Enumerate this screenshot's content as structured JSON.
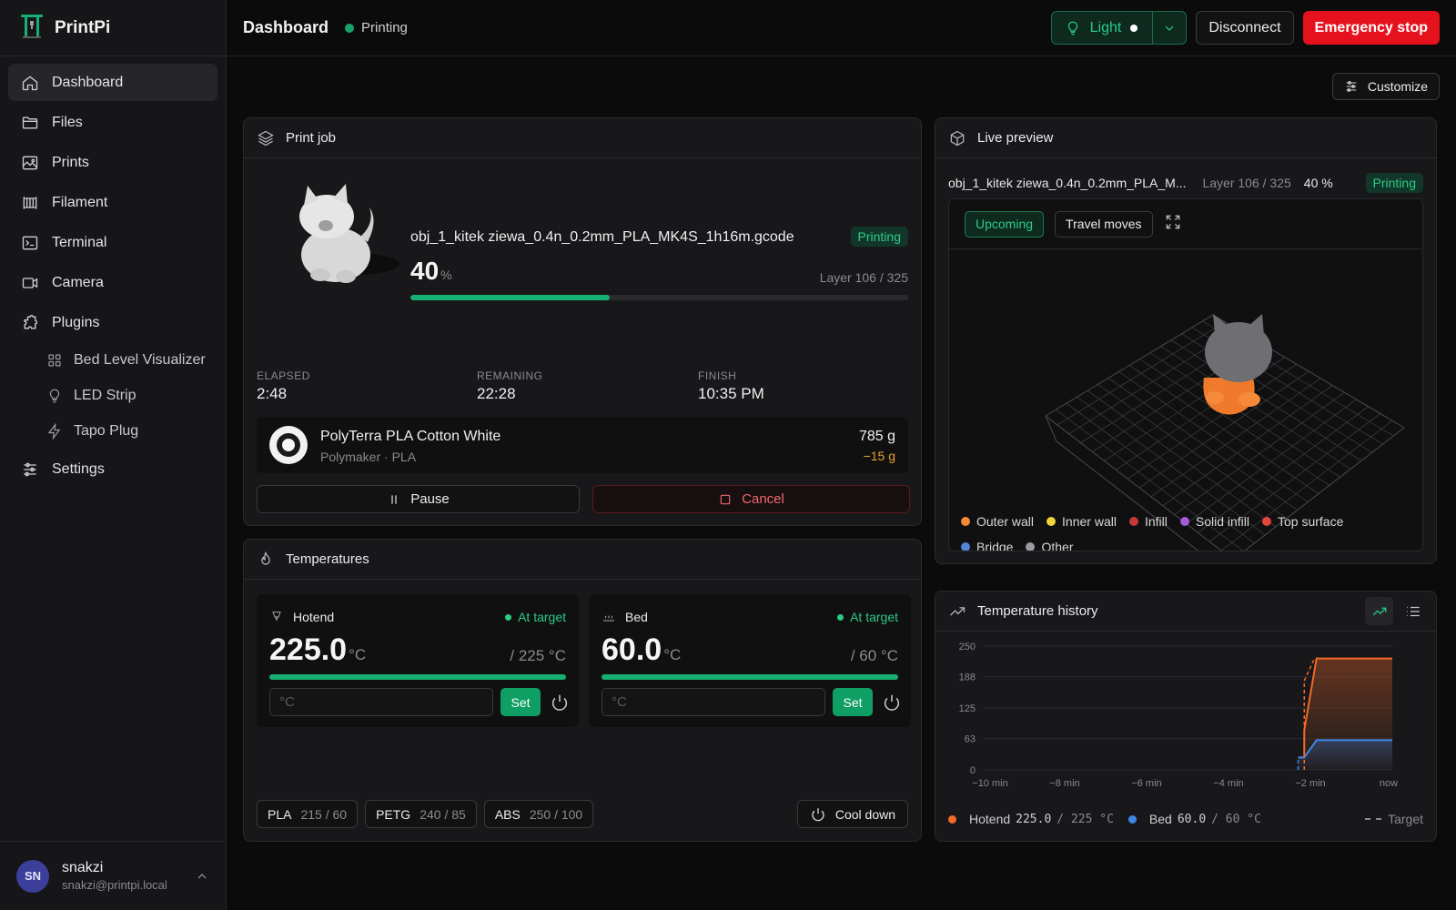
{
  "app": {
    "name": "PrintPi"
  },
  "colors": {
    "accent": "#16b072",
    "danger": "#e5121e",
    "hotend": "#f26a2a",
    "bed": "#3d86e8"
  },
  "sidebar": {
    "items": [
      {
        "label": "Dashboard",
        "icon": "home-icon"
      },
      {
        "label": "Files",
        "icon": "folder-icon"
      },
      {
        "label": "Prints",
        "icon": "image-icon"
      },
      {
        "label": "Filament",
        "icon": "filament-icon"
      },
      {
        "label": "Terminal",
        "icon": "terminal-icon"
      },
      {
        "label": "Camera",
        "icon": "camera-icon"
      },
      {
        "label": "Plugins",
        "icon": "puzzle-icon"
      }
    ],
    "plugins": [
      {
        "label": "Bed Level Visualizer",
        "icon": "grid-icon"
      },
      {
        "label": "LED Strip",
        "icon": "bulb-icon"
      },
      {
        "label": "Tapo Plug",
        "icon": "bolt-icon"
      }
    ],
    "settings": {
      "label": "Settings",
      "icon": "sliders-icon"
    },
    "user": {
      "initials": "SN",
      "name": "snakzi",
      "email": "snakzi@printpi.local"
    }
  },
  "topbar": {
    "title": "Dashboard",
    "status": "Printing",
    "light_label": "Light",
    "disconnect_label": "Disconnect",
    "emergency_label": "Emergency stop"
  },
  "customize_label": "Customize",
  "print_job": {
    "title": "Print job",
    "file": "obj_1_kitek ziewa_0.4n_0.2mm_PLA_MK4S_1h16m.gcode",
    "status": "Printing",
    "percent": "40",
    "percent_unit": "%",
    "progress": 40,
    "layer": "Layer 106 / 325",
    "stats": [
      {
        "label": "ELAPSED",
        "value": "2:48"
      },
      {
        "label": "REMAINING",
        "value": "22:28"
      },
      {
        "label": "FINISH",
        "value": "10:35 PM"
      }
    ],
    "filament": {
      "name": "PolyTerra PLA Cotton White",
      "sub": "Polymaker · PLA",
      "weight": "785 g",
      "delta": "−15 g"
    },
    "pause_label": "Pause",
    "cancel_label": "Cancel"
  },
  "temperatures": {
    "title": "Temperatures",
    "at_target": "At target",
    "hotend": {
      "label": "Hotend",
      "value": "225.0",
      "unit": "°C",
      "target": "/ 225 °C",
      "placeholder": "°C",
      "set_label": "Set"
    },
    "bed": {
      "label": "Bed",
      "value": "60.0",
      "unit": "°C",
      "target": "/ 60 °C",
      "placeholder": "°C",
      "set_label": "Set"
    },
    "presets": [
      {
        "name": "PLA",
        "values": "215 / 60"
      },
      {
        "name": "PETG",
        "values": "240 / 85"
      },
      {
        "name": "ABS",
        "values": "250 / 100"
      }
    ],
    "cooldown_label": "Cool down"
  },
  "preview": {
    "title": "Live preview",
    "file": "obj_1_kitek ziewa_0.4n_0.2mm_PLA_M...",
    "layer": "Layer 106 / 325",
    "percent": "40 %",
    "status": "Printing",
    "upcoming_label": "Upcoming",
    "travel_label": "Travel moves",
    "legend": [
      {
        "label": "Outer wall",
        "color": "#f58a3a"
      },
      {
        "label": "Inner wall",
        "color": "#f3d33a"
      },
      {
        "label": "Infill",
        "color": "#c43a3a"
      },
      {
        "label": "Solid infill",
        "color": "#a45ad8"
      },
      {
        "label": "Top surface",
        "color": "#e2463f"
      },
      {
        "label": "Bridge",
        "color": "#4f86d8"
      },
      {
        "label": "Other",
        "color": "#9a9aa0"
      }
    ]
  },
  "history": {
    "title": "Temperature history",
    "legend": {
      "hotend_label": "Hotend",
      "hotend_value": "225.0",
      "hotend_target": "/ 225 °C",
      "bed_label": "Bed",
      "bed_value": "60.0",
      "bed_target": "/ 60 °C",
      "target_label": "Target"
    },
    "chart_data": {
      "type": "line",
      "x": [
        -10,
        -2.3,
        -2.2,
        -2.15,
        -1.85,
        0
      ],
      "xticks": [
        "−10 min",
        "−8 min",
        "−6 min",
        "−4 min",
        "−2 min",
        "now"
      ],
      "xtick_values": [
        -10,
        -8,
        -6,
        -4,
        -2,
        0
      ],
      "yticks": [
        "0",
        "63",
        "125",
        "188",
        "250"
      ],
      "ytick_values": [
        0,
        63,
        125,
        188,
        250
      ],
      "ylim": [
        0,
        250
      ],
      "xlim": [
        -10,
        0
      ],
      "series": [
        {
          "name": "Hotend",
          "points": [
            [
              -2.3,
              25
            ],
            [
              -2.15,
              25
            ],
            [
              -2.15,
              80
            ],
            [
              -1.85,
              225
            ],
            [
              0,
              225
            ]
          ],
          "color": "#f26a2a"
        },
        {
          "name": "Bed",
          "points": [
            [
              -2.3,
              25
            ],
            [
              -2.15,
              25
            ],
            [
              -1.85,
              60
            ],
            [
              0,
              60
            ]
          ],
          "color": "#3d86e8"
        }
      ],
      "targets": [
        {
          "name": "Hotend",
          "points": [
            [
              -2.15,
              0
            ],
            [
              -2.15,
              180
            ],
            [
              -1.9,
              225
            ]
          ]
        },
        {
          "name": "Bed",
          "points": [
            [
              -2.3,
              0
            ],
            [
              -2.3,
              25
            ]
          ]
        }
      ]
    }
  }
}
